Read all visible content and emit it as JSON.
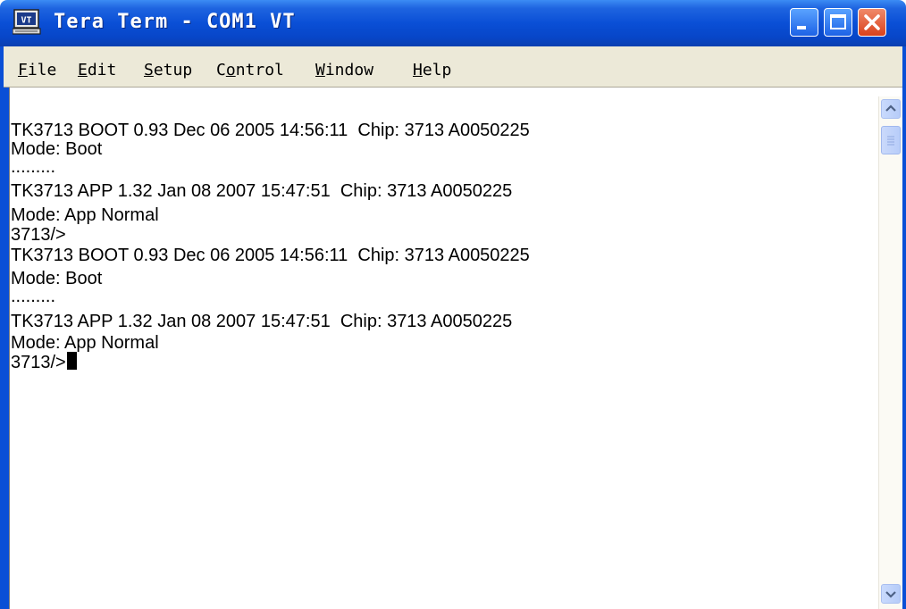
{
  "window": {
    "title": "Tera Term - COM1 VT",
    "app_icon_text": "VT",
    "accent_color": "#0a4fd6"
  },
  "menu": {
    "items": [
      {
        "accel": "F",
        "rest": "ile"
      },
      {
        "accel": "E",
        "rest": "dit"
      },
      {
        "accel": "S",
        "rest": "etup"
      },
      {
        "pre": "C",
        "accel": "o",
        "rest": "ntrol"
      },
      {
        "accel": "W",
        "rest": "indow"
      },
      {
        "accel": "H",
        "rest": "elp"
      }
    ]
  },
  "terminal": {
    "lines": [
      "TK3713 BOOT 0.93 Dec 06 2005 14:56:11  Chip: 3713 A0050225",
      "Mode: Boot",
      ".........",
      "TK3713 APP 1.32 Jan 08 2007 15:47:51  Chip: 3713 A0050225",
      "Mode: App Normal",
      "3713/>",
      "TK3713 BOOT 0.93 Dec 06 2005 14:56:11  Chip: 3713 A0050225",
      "Mode: Boot",
      ".........",
      "TK3713 APP 1.32 Jan 08 2007 15:47:51  Chip: 3713 A0050225",
      "Mode: App Normal",
      "3713/>"
    ]
  },
  "icons": {
    "minimize": "minimize-icon",
    "maximize": "maximize-icon",
    "close": "close-icon",
    "scroll_up": "chevron-up-icon",
    "scroll_down": "chevron-down-icon"
  }
}
